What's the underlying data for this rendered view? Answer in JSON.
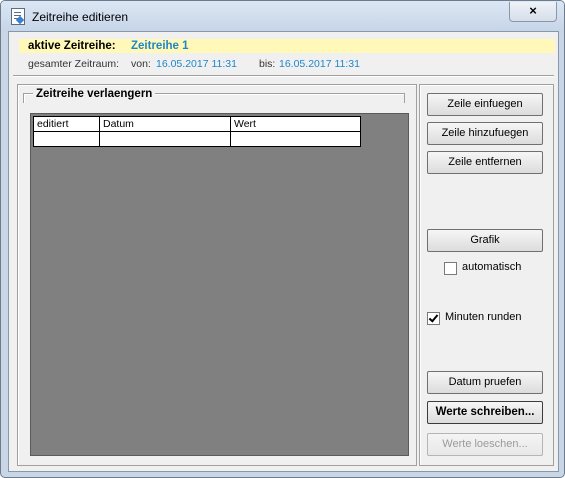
{
  "window": {
    "title": "Zeitreihe editieren",
    "close_label": "×"
  },
  "header": {
    "active_label": "aktive Zeitreihe:",
    "active_value": "Zeitreihe 1",
    "range_label": "gesamter Zeitraum:",
    "von_label": "von:",
    "von_value": "16.05.2017 11:31",
    "bis_label": "bis:",
    "bis_value": "16.05.2017 11:31"
  },
  "group": {
    "title": "Zeitreihe verlaengern"
  },
  "grid": {
    "columns": [
      "editiert",
      "Datum",
      "Wert"
    ],
    "rows": [
      [
        "",
        "",
        ""
      ]
    ]
  },
  "buttons": {
    "insert": "Zeile einfuegen",
    "append": "Zeile hinzufuegen",
    "remove": "Zeile entfernen",
    "graphic": "Grafik",
    "check_date": "Datum pruefen",
    "write_values": "Werte schreiben...",
    "delete_values": "Werte loeschen..."
  },
  "checkboxes": {
    "automatic": {
      "label": "automatisch",
      "checked": false
    },
    "round_minutes": {
      "label": "Minuten runden",
      "checked": true
    }
  },
  "colors": {
    "accent": "#1e87c9",
    "highlight": "#fff8b8",
    "grid_background": "#808080"
  }
}
